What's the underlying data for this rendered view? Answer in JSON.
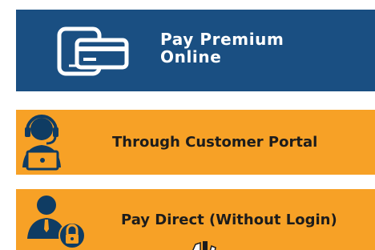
{
  "pay_online": {
    "label_line1": "Pay Premium",
    "label_line2": "Online",
    "icon": "card-on-tablet-icon",
    "bg_color": "#1a4f82",
    "text_color": "#ffffff"
  },
  "customer_portal": {
    "label": "Through Customer Portal",
    "icon": "support-agent-laptop-icon",
    "bg_color": "#f7a126"
  },
  "pay_direct": {
    "label": "Pay Direct (Without Login)",
    "icon": "user-lock-icon",
    "bg_color": "#f7a126"
  }
}
